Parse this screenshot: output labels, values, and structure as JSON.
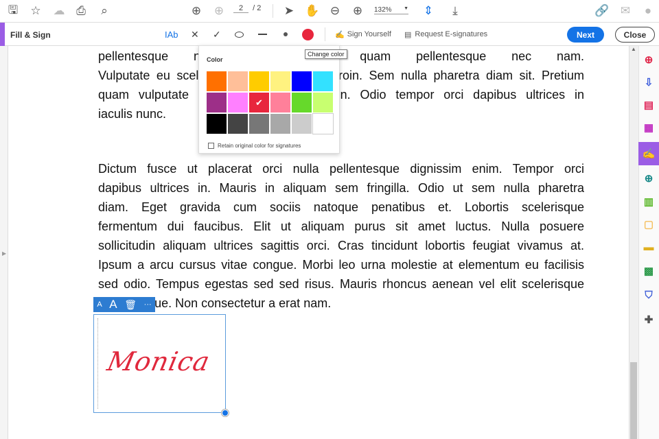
{
  "topbar": {
    "page_current": "2",
    "page_total": "/ 2",
    "zoom": "132%"
  },
  "fillsign": {
    "title": "Fill & Sign",
    "text_tool": "IAb",
    "cross": "✕",
    "check": "✓",
    "sign_yourself": "Sign Yourself",
    "request_esign": "Request E-signatures",
    "next": "Next",
    "close": "Close",
    "current_color": "#e8263d"
  },
  "tooltip": "Change color",
  "color_popup": {
    "title": "Color",
    "swatches": [
      "#ff7000",
      "#ffbf99",
      "#ffcc00",
      "#fff280",
      "#0000ff",
      "#33e1ff",
      "#9d2f88",
      "#ff80ff",
      "#e8263d",
      "#ff809a",
      "#66d92b",
      "#c8ff70",
      "#000000",
      "#444444",
      "#777777",
      "#a8a8a8",
      "#cccccc",
      "#ffffff"
    ],
    "selected_index": 8,
    "retain_label": "Retain original color for signatures",
    "retain_checked": false
  },
  "document": {
    "para1": [
      "pellentesque nec nam. Tempus quam pellentesque nec nam.",
      "Vulputate eu scelerisque felis imperdiet proin. Sem nulla pharetra diam sit. Pretium",
      "quam vulputate dignissim suspendisse in. Odio tempor orci dapibus ultrices in",
      "iaculis nunc."
    ],
    "para2": [
      "Dictum fusce ut placerat orci nulla pellentesque dignissim enim. Tempor orci",
      "dapibus ultrices in. Mauris in aliquam sem fringilla. Odio ut sem nulla pharetra",
      "diam. Eget gravida cum sociis natoque penatibus et. Lobortis scelerisque",
      "fermentum dui faucibus. Elit ut aliquam purus sit amet luctus. Nulla posuere",
      "sollicitudin aliquam ultrices sagittis orci. Cras tincidunt lobortis feugiat vivamus at.",
      "Ipsum a arcu cursus vitae congue. Morbi leo urna molestie at elementum eu facilisis",
      "sed odio. Tempus egestas sed sed risus. Mauris rhoncus aenean vel elit scelerisque",
      "pellentesque. Non consectetur a erat nam."
    ]
  },
  "signature": {
    "text": "Monica",
    "color": "#e0283c",
    "toolbar": {
      "small_a": "A",
      "large_a": "A",
      "more": "···"
    }
  }
}
